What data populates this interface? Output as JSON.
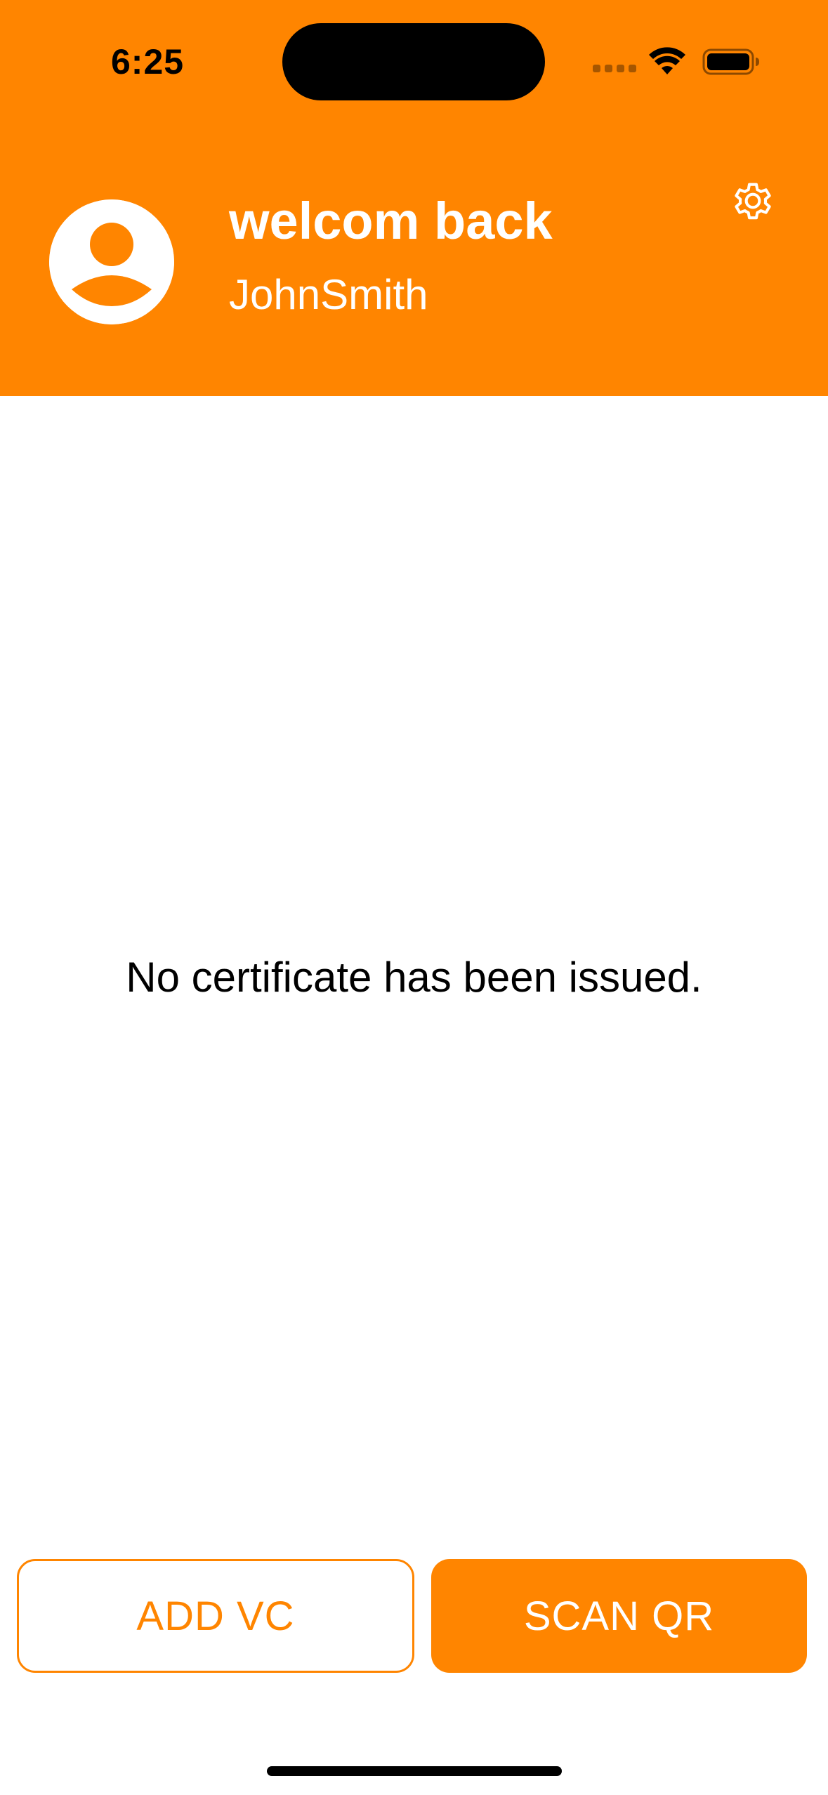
{
  "status_bar": {
    "time": "6:25"
  },
  "header": {
    "greeting": "welcom back",
    "username": "JohnSmith",
    "settings_icon": "gear-icon",
    "avatar_icon": "user-avatar-icon"
  },
  "main": {
    "empty_message": "No certificate has been issued."
  },
  "actions": {
    "add_vc_label": "ADD VC",
    "scan_qr_label": "SCAN QR"
  },
  "colors": {
    "accent": "#FF8500",
    "background": "#FFFFFF",
    "text": "#000000"
  }
}
